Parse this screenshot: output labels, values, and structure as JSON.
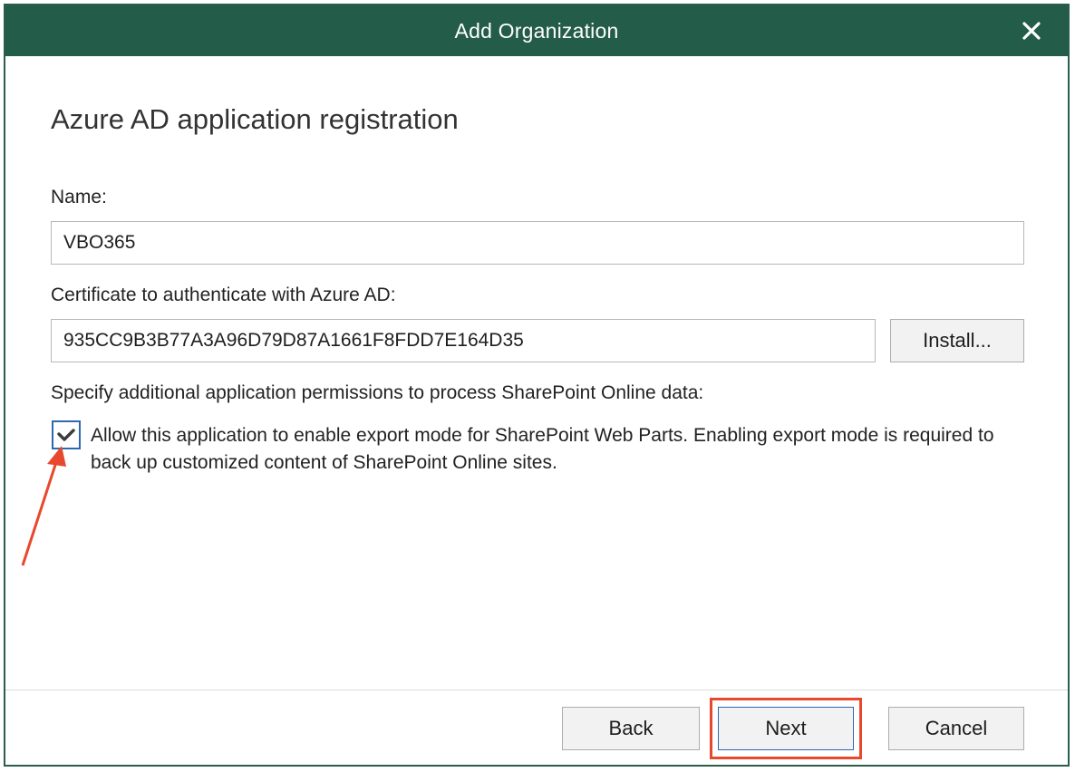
{
  "window": {
    "title": "Add Organization"
  },
  "page": {
    "heading": "Azure AD application registration"
  },
  "form": {
    "name_label": "Name:",
    "name_value": "VBO365",
    "cert_label": "Certificate to authenticate with Azure AD:",
    "cert_value": "935CC9B3B77A3A96D79D87A1661F8FDD7E164D35",
    "install_label": "Install...",
    "permissions_label": "Specify additional application permissions to process SharePoint Online data:",
    "export_checkbox_label": "Allow this application to enable export mode for SharePoint Web Parts. Enabling export mode is required to back up customized content of SharePoint Online sites.",
    "export_checked": true
  },
  "footer": {
    "back_label": "Back",
    "next_label": "Next",
    "cancel_label": "Cancel"
  },
  "icons": {
    "close": "close-icon",
    "check": "checkmark-icon"
  },
  "colors": {
    "titlebar": "#235c48",
    "annotation": "#e8492e",
    "checkbox_border": "#2e68b3"
  }
}
